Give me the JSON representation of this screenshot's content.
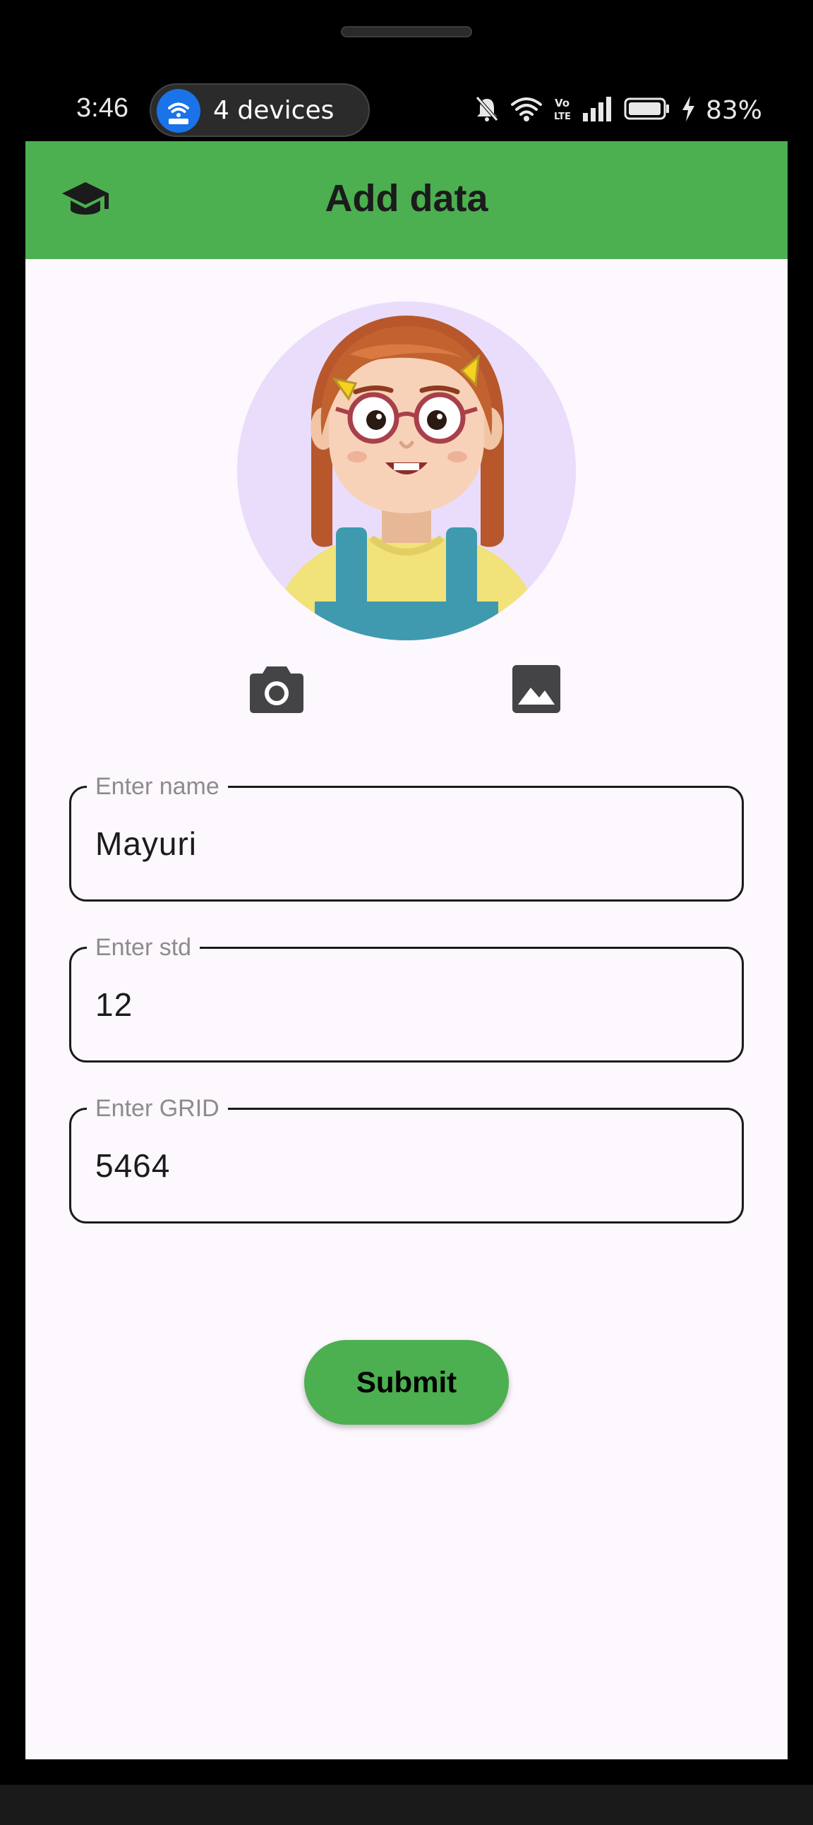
{
  "status_bar": {
    "time": "3:46",
    "connected_devices_label": "4 devices",
    "battery_percent": "83%",
    "icons": [
      "wifi-hotspot-icon",
      "mute-icon",
      "wifi-icon",
      "volte-icon",
      "signal-icon",
      "battery-icon",
      "charging-icon"
    ]
  },
  "app_bar": {
    "title": "Add data",
    "leading_icon": "graduation-cap-icon",
    "color": "#4caf50"
  },
  "avatar": {
    "icon": "avatar-girl-illustration",
    "background": "#e9ddfb"
  },
  "image_actions": {
    "camera_icon": "camera-icon",
    "gallery_icon": "image-gallery-icon"
  },
  "form": {
    "fields": [
      {
        "label": "Enter name",
        "value": "Mayuri"
      },
      {
        "label": "Enter std",
        "value": "12"
      },
      {
        "label": "Enter GRID",
        "value": "5464"
      }
    ],
    "submit_label": "Submit"
  },
  "colors": {
    "accent": "#4caf50",
    "screen_background": "#fdf7fe"
  }
}
